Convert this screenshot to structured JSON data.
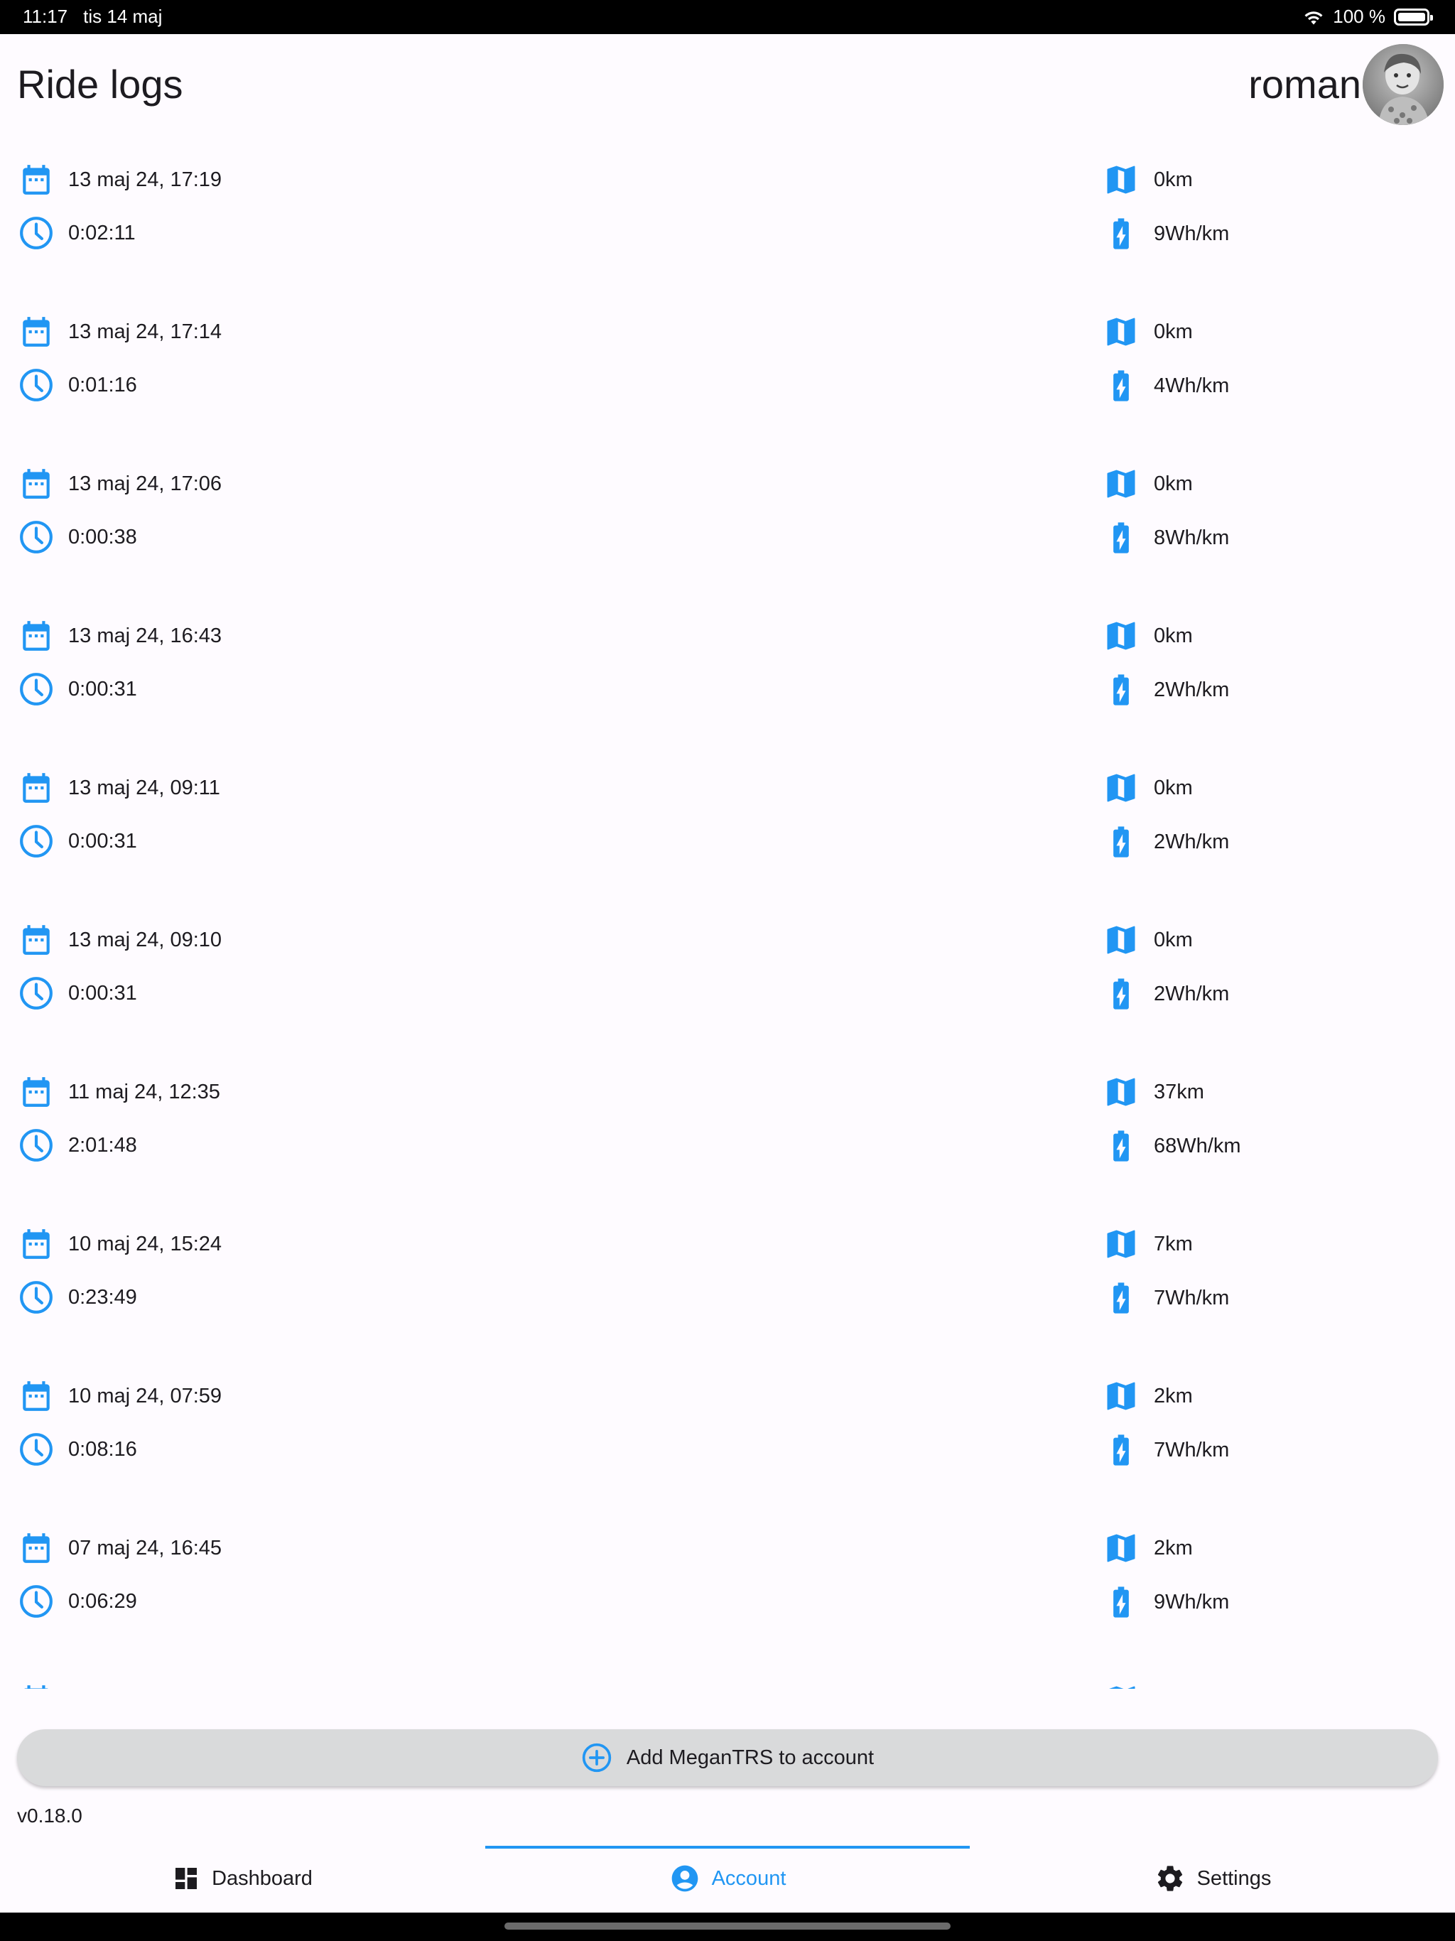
{
  "status_bar": {
    "time": "11:17",
    "date": "tis 14 maj",
    "battery_percent": "100 %"
  },
  "header": {
    "title": "Ride logs",
    "user_name": "roman"
  },
  "rides": [
    {
      "date": "13 maj 24, 17:19",
      "duration": "0:02:11",
      "distance": "0km",
      "energy": "9Wh/km"
    },
    {
      "date": "13 maj 24, 17:14",
      "duration": "0:01:16",
      "distance": "0km",
      "energy": "4Wh/km"
    },
    {
      "date": "13 maj 24, 17:06",
      "duration": "0:00:38",
      "distance": "0km",
      "energy": "8Wh/km"
    },
    {
      "date": "13 maj 24, 16:43",
      "duration": "0:00:31",
      "distance": "0km",
      "energy": "2Wh/km"
    },
    {
      "date": "13 maj 24, 09:11",
      "duration": "0:00:31",
      "distance": "0km",
      "energy": "2Wh/km"
    },
    {
      "date": "13 maj 24, 09:10",
      "duration": "0:00:31",
      "distance": "0km",
      "energy": "2Wh/km"
    },
    {
      "date": "11 maj 24, 12:35",
      "duration": "2:01:48",
      "distance": "37km",
      "energy": "68Wh/km"
    },
    {
      "date": "10 maj 24, 15:24",
      "duration": "0:23:49",
      "distance": "7km",
      "energy": "7Wh/km"
    },
    {
      "date": "10 maj 24, 07:59",
      "duration": "0:08:16",
      "distance": "2km",
      "energy": "7Wh/km"
    },
    {
      "date": "07 maj 24, 16:45",
      "duration": "0:06:29",
      "distance": "2km",
      "energy": "9Wh/km"
    },
    {
      "date": "",
      "duration": "",
      "distance": "",
      "energy": ""
    }
  ],
  "add_button": {
    "label": "Add MeganTRS to account",
    "icon": "add-circle-outline-icon"
  },
  "version": "v0.18.0",
  "bottom_nav": {
    "items": [
      {
        "label": "Dashboard",
        "icon": "dashboard-icon"
      },
      {
        "label": "Account",
        "icon": "account-circle-icon"
      },
      {
        "label": "Settings",
        "icon": "gear-icon"
      }
    ],
    "active_index": 1
  },
  "colors": {
    "accent": "#2196f3",
    "background": "#fefbff",
    "text": "#1d1b20",
    "button_bg": "#d9dadb"
  }
}
